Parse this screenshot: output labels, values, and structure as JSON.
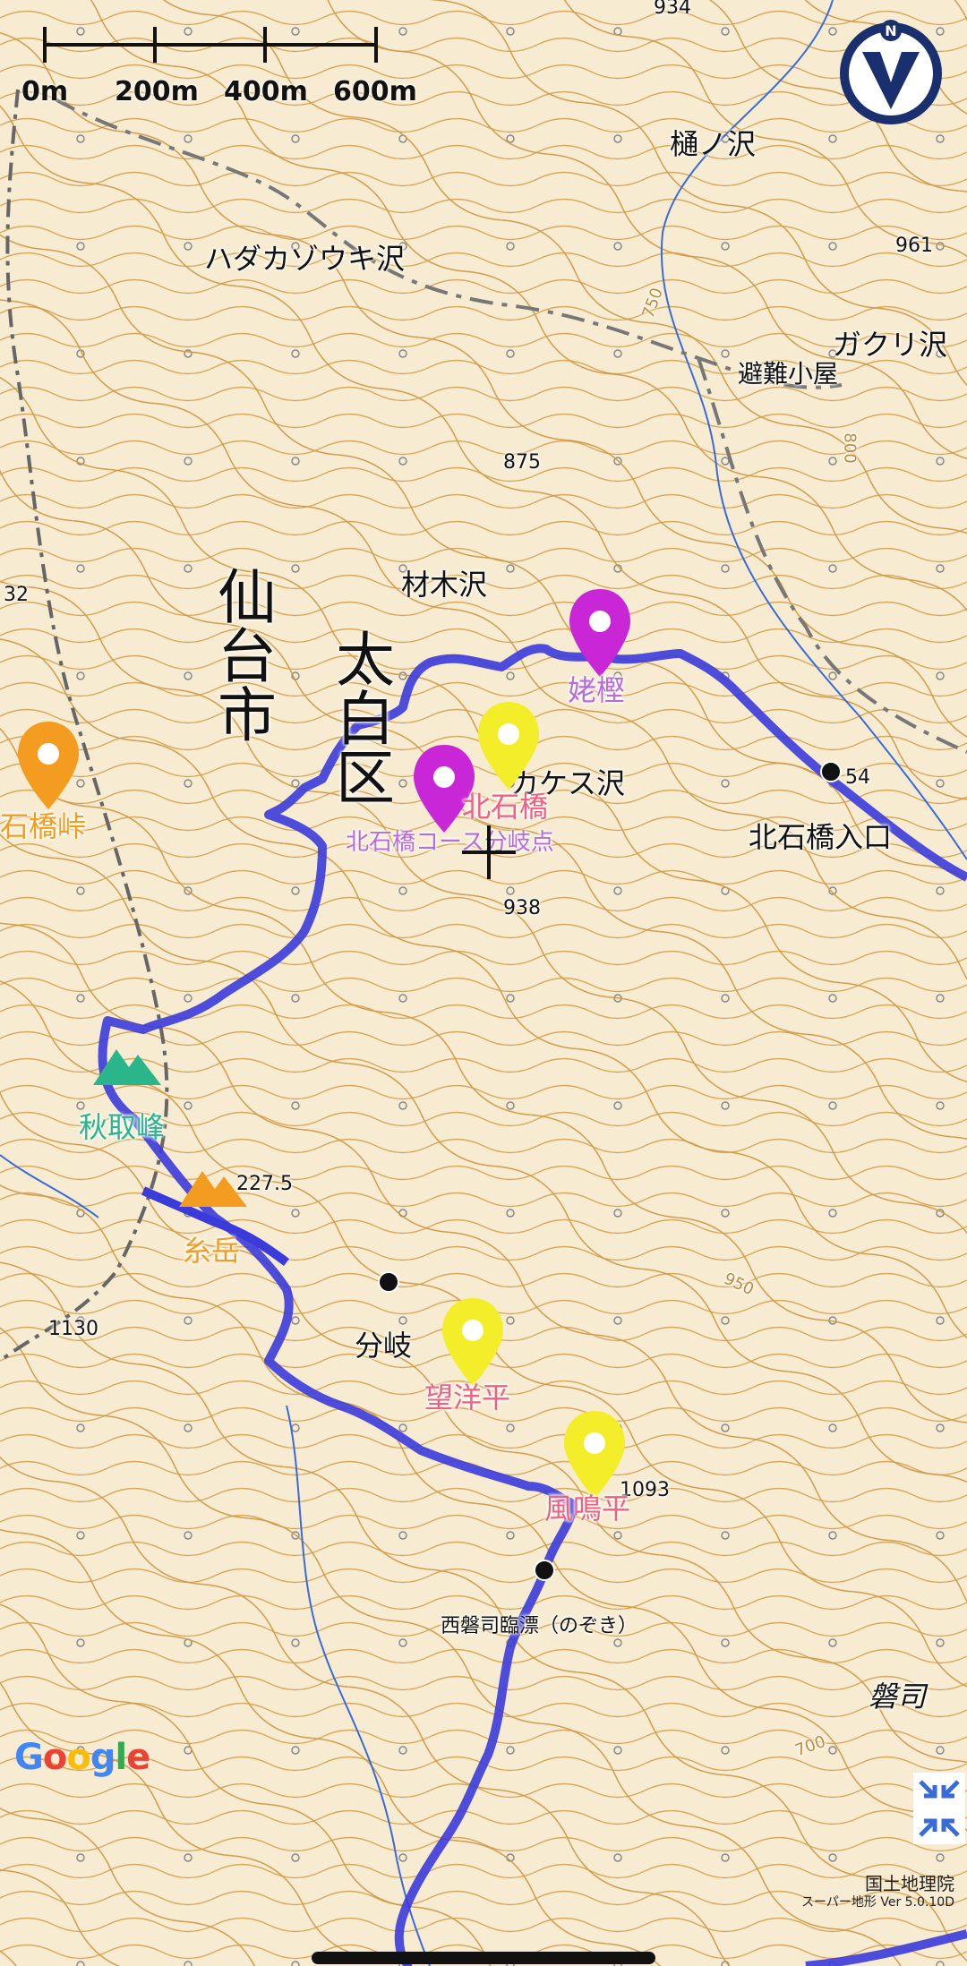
{
  "map": {
    "scale": {
      "labels": [
        "0m",
        "200m",
        "400m",
        "600m"
      ]
    },
    "compass": {
      "letter": "N"
    },
    "places": {
      "sendai_shi": "仙台市",
      "taihaku_ku": "太白区",
      "hidano_sawa": "樋ノ沢",
      "hadakazouki_sawa": "ハダカゾウキ沢",
      "gakuri_sawa": "ガクリ沢",
      "hinan_goya": "避難小屋",
      "zaimoku_sawa": "材木沢",
      "kakesu_sawa": "カケス沢",
      "kitaishibashi_iriguchi": "北石橋入口",
      "bunki": "分岐",
      "nishibandai": "西磐司臨漂（のぞき）",
      "bandai": "磐司"
    },
    "elevations": [
      "934",
      "961",
      "875",
      "32",
      "938",
      "54",
      "227.5",
      "1130",
      "1093"
    ],
    "contour_labels": [
      "750",
      "800",
      "950",
      "700"
    ],
    "pins": {
      "uba_kashi": {
        "label": "姥樫",
        "color": "#c826d6"
      },
      "kitaishibashi": {
        "label": "北石橋",
        "color": "#c826d6"
      },
      "kakesu": {
        "label": "",
        "color": "#f4ee2a"
      },
      "kitaishibashi_course": {
        "label": "北石橋コース分岐点"
      },
      "boyodaira": {
        "label": "望洋平",
        "color": "#f4ee2a"
      },
      "fumeidaira": {
        "label": "風鳴平",
        "color": "#f4ee2a"
      },
      "ishibashi_toge": {
        "label": "石橋峠",
        "color": "#f39c1f"
      }
    },
    "peaks": {
      "akitorimine": {
        "label": "秋取峰",
        "color": "#2bb58a"
      },
      "itodake": {
        "label": "糸岳",
        "color": "#f39c1f"
      }
    },
    "route_color": "#3b3bdb",
    "google": "Google",
    "attribution": {
      "line1": "国土地理院",
      "line2": "スーパー地形 Ver 5.0.10D"
    }
  }
}
